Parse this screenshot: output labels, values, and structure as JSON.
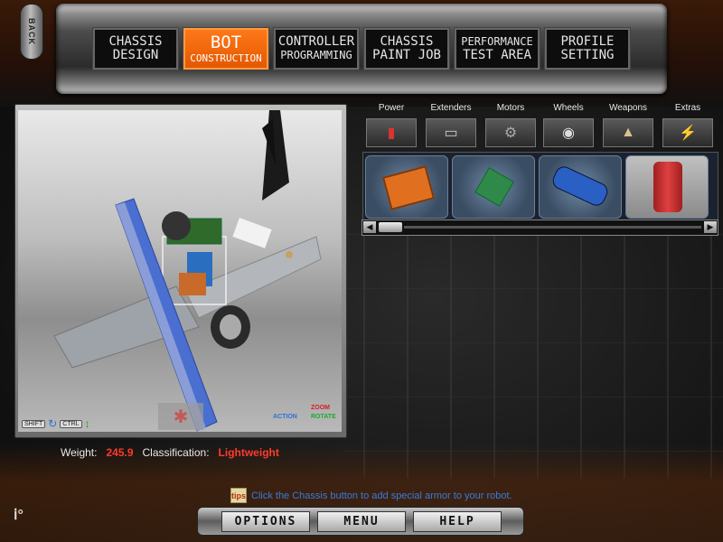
{
  "nav": {
    "back_label": "BACK",
    "buttons": [
      {
        "line1": "CHASSIS",
        "line2": "DESIGN"
      },
      {
        "line1": "BOT",
        "line2": "CONSTRUCTION"
      },
      {
        "line1": "CONTROLLER",
        "line2": "PROGRAMMING"
      },
      {
        "line1": "CHASSIS",
        "line2": "PAINT JOB"
      },
      {
        "line1": "PERFORMANCE",
        "line2": "TEST AREA"
      },
      {
        "line1": "PROFILE",
        "line2": "SETTING"
      }
    ],
    "active_index": 1
  },
  "viewport": {
    "shift_key": "SHIFT",
    "ctrl_key": "CTRL",
    "action_label": "ACTION",
    "zoom_label": "ZOOM",
    "rotate_label": "ROTATE"
  },
  "categories": [
    {
      "label": "Power",
      "icon": "battery-icon"
    },
    {
      "label": "Extenders",
      "icon": "extender-bar-icon"
    },
    {
      "label": "Motors",
      "icon": "motor-icon"
    },
    {
      "label": "Wheels",
      "icon": "wheel-icon"
    },
    {
      "label": "Weapons",
      "icon": "weapon-icon"
    },
    {
      "label": "Extras",
      "icon": "extras-icon"
    }
  ],
  "parts": [
    {
      "name": "orange-board-part",
      "color": "#e07020"
    },
    {
      "name": "green-circuit-part",
      "color": "#2f8a4a"
    },
    {
      "name": "pump-part",
      "color": "#2a5fc4"
    },
    {
      "name": "canister-part",
      "color": "#c8302a"
    }
  ],
  "status": {
    "weight_label": "Weight:",
    "weight_value": "245.9",
    "class_label": "Classification:",
    "class_value": "Lightweight"
  },
  "tip": {
    "icon_text": "tips",
    "text": "Click the Chassis button to add special armor to your robot."
  },
  "bottom": {
    "options": "OPTIONS",
    "menu": "MENU",
    "help": "HELP"
  },
  "colors": {
    "accent": "#e35600",
    "warning": "#ff3b2e",
    "tip": "#3a7bd8"
  }
}
